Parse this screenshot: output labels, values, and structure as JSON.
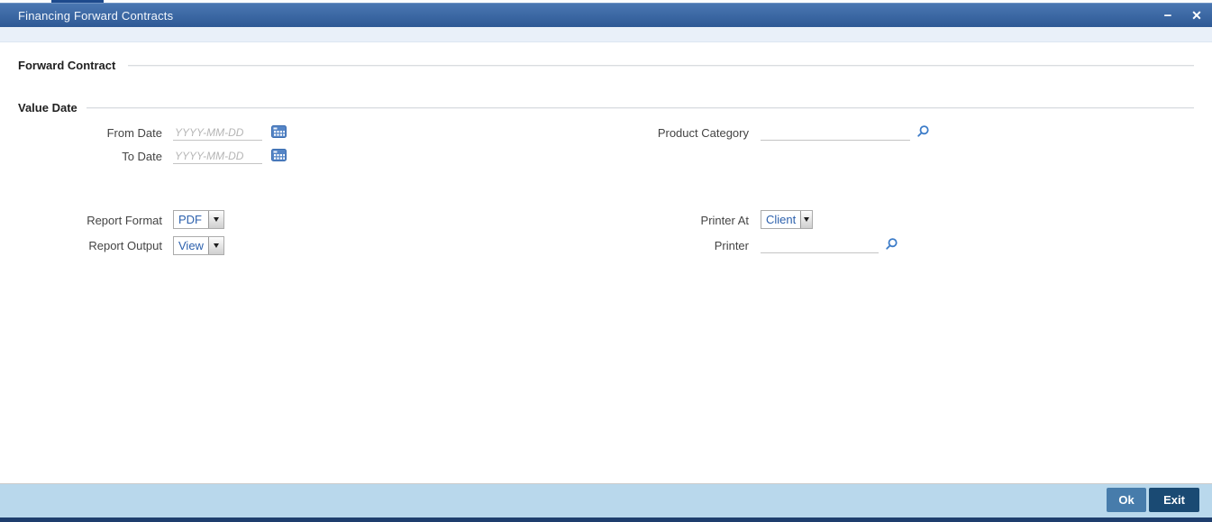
{
  "window": {
    "title": "Financing Forward Contracts",
    "minimize_glyph": "−",
    "close_glyph": "✕"
  },
  "sections": {
    "forward_contract_heading": "Forward Contract",
    "value_date_heading": "Value Date"
  },
  "fields": {
    "from_date": {
      "label": "From Date",
      "value": "",
      "placeholder": "YYYY-MM-DD"
    },
    "to_date": {
      "label": "To Date",
      "value": "",
      "placeholder": "YYYY-MM-DD"
    },
    "product_category": {
      "label": "Product Category",
      "value": ""
    },
    "report_format": {
      "label": "Report Format",
      "value": "PDF"
    },
    "report_output": {
      "label": "Report Output",
      "value": "View"
    },
    "printer_at": {
      "label": "Printer At",
      "value": "Client"
    },
    "printer": {
      "label": "Printer",
      "value": ""
    }
  },
  "footer": {
    "ok_label": "Ok",
    "exit_label": "Exit"
  },
  "colors": {
    "titlebar_blue": "#2e5995",
    "subheader_blue": "#e9f0f9",
    "footer_blue": "#b9d8ec",
    "footer_line_navy": "#1e3e6d",
    "ok_button_blue": "#477cab",
    "exit_button_navy": "#1a4a73",
    "dropdown_text_blue": "#2d61ad",
    "icon_blue": "#3b7bc8"
  }
}
